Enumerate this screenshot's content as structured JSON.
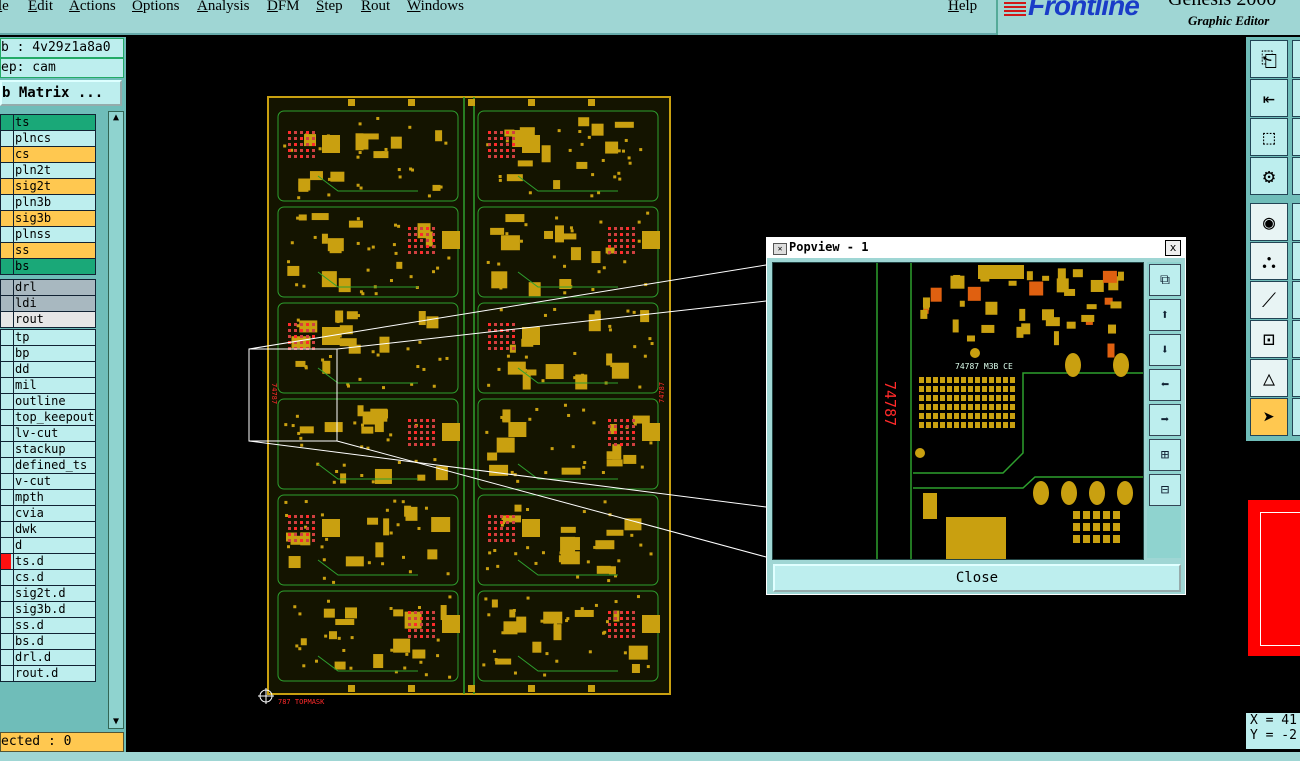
{
  "menubar": {
    "items": [
      "le",
      "Edit",
      "Actions",
      "Options",
      "Analysis",
      "DFM",
      "Step",
      "Rout",
      "Windows"
    ],
    "help": "Help"
  },
  "brand": {
    "logo": "Frontline",
    "product": "Genesis 2000",
    "subtitle": "Graphic Editor"
  },
  "left_panel": {
    "job": "b : 4v29z1a8a0",
    "step": "ep: cam",
    "matrix_button": "b Matrix ...",
    "layers": [
      {
        "name": "ts",
        "color": "#1aa878",
        "swatch": "#1aa878"
      },
      {
        "name": "plncs",
        "color": "#bdeeee",
        "swatch": "#bdeeee"
      },
      {
        "name": "cs",
        "color": "#ffc850",
        "swatch": "#ffc850"
      },
      {
        "name": "pln2t",
        "color": "#bdeeee",
        "swatch": "#bdeeee"
      },
      {
        "name": "sig2t",
        "color": "#ffc850",
        "swatch": "#ffc850"
      },
      {
        "name": "pln3b",
        "color": "#bdeeee",
        "swatch": "#bdeeee"
      },
      {
        "name": "sig3b",
        "color": "#ffc850",
        "swatch": "#ffc850"
      },
      {
        "name": "plnss",
        "color": "#bdeeee",
        "swatch": "#bdeeee"
      },
      {
        "name": "ss",
        "color": "#ffc850",
        "swatch": "#ffc850"
      },
      {
        "name": "bs",
        "color": "#1aa878",
        "swatch": "#1aa878"
      },
      {
        "name": "drl",
        "color": "#a8b8c0",
        "swatch": "#a8b8c0"
      },
      {
        "name": "ldi",
        "color": "#a8b8c0",
        "swatch": "#a8b8c0"
      },
      {
        "name": "rout",
        "color": "#e6e6e6",
        "swatch": "#e6e6e6"
      },
      {
        "name": "tp",
        "color": "#bdeeee",
        "swatch": "#bdeeee"
      },
      {
        "name": "bp",
        "color": "#bdeeee",
        "swatch": "#bdeeee"
      },
      {
        "name": "dd",
        "color": "#bdeeee",
        "swatch": "#bdeeee"
      },
      {
        "name": "mil",
        "color": "#bdeeee",
        "swatch": "#bdeeee"
      },
      {
        "name": "outline",
        "color": "#bdeeee",
        "swatch": "#bdeeee"
      },
      {
        "name": "top_keepout",
        "color": "#bdeeee",
        "swatch": "#bdeeee"
      },
      {
        "name": "lv-cut",
        "color": "#bdeeee",
        "swatch": "#bdeeee"
      },
      {
        "name": "stackup",
        "color": "#bdeeee",
        "swatch": "#bdeeee"
      },
      {
        "name": "defined_ts",
        "color": "#bdeeee",
        "swatch": "#bdeeee"
      },
      {
        "name": "v-cut",
        "color": "#bdeeee",
        "swatch": "#bdeeee"
      },
      {
        "name": "mpth",
        "color": "#bdeeee",
        "swatch": "#bdeeee"
      },
      {
        "name": "cvia",
        "color": "#bdeeee",
        "swatch": "#bdeeee"
      },
      {
        "name": "dwk",
        "color": "#bdeeee",
        "swatch": "#bdeeee"
      },
      {
        "name": "d",
        "color": "#bdeeee",
        "swatch": "#bdeeee"
      },
      {
        "name": "ts.d",
        "color": "#bdeeee",
        "swatch": "#ff1010"
      },
      {
        "name": "cs.d",
        "color": "#bdeeee",
        "swatch": "#bdeeee"
      },
      {
        "name": "sig2t.d",
        "color": "#bdeeee",
        "swatch": "#bdeeee"
      },
      {
        "name": "sig3b.d",
        "color": "#bdeeee",
        "swatch": "#bdeeee"
      },
      {
        "name": "ss.d",
        "color": "#bdeeee",
        "swatch": "#bdeeee"
      },
      {
        "name": "bs.d",
        "color": "#bdeeee",
        "swatch": "#bdeeee"
      },
      {
        "name": "drl.d",
        "color": "#bdeeee",
        "swatch": "#bdeeee"
      },
      {
        "name": "rout.d",
        "color": "#bdeeee",
        "swatch": "#bdeeee"
      }
    ],
    "selected": "ected : 0"
  },
  "canvas": {
    "board_label_left": "74787",
    "board_label_right": "74787",
    "bottom_text": "787  TOPMASK"
  },
  "popview": {
    "title": "Popview - 1",
    "close_x": "x",
    "close_button": "Close",
    "panel_number": "74787",
    "part_text": "74787  M3B  CE",
    "tools": [
      "zoom-fit-icon",
      "pan-up-icon",
      "pan-down-icon",
      "pan-left-icon",
      "pan-right-icon",
      "zoom-in-icon",
      "zoom-out-icon"
    ]
  },
  "right_tools": {
    "icons": [
      "paste-icon",
      "move-icon",
      "transform-icon",
      "properties-icon",
      "camera-icon",
      "nodes-icon",
      "draw-line-icon",
      "snap-icon",
      "triangle-icon",
      "pointer-icon"
    ]
  },
  "coords": {
    "x": "X = 41",
    "y": "Y = -2"
  },
  "colors": {
    "ui_bg": "#9fd6d4",
    "pad_gold": "#c9a010",
    "trace_green": "#2ea02e",
    "highlight_red": "#ff2a2a"
  }
}
